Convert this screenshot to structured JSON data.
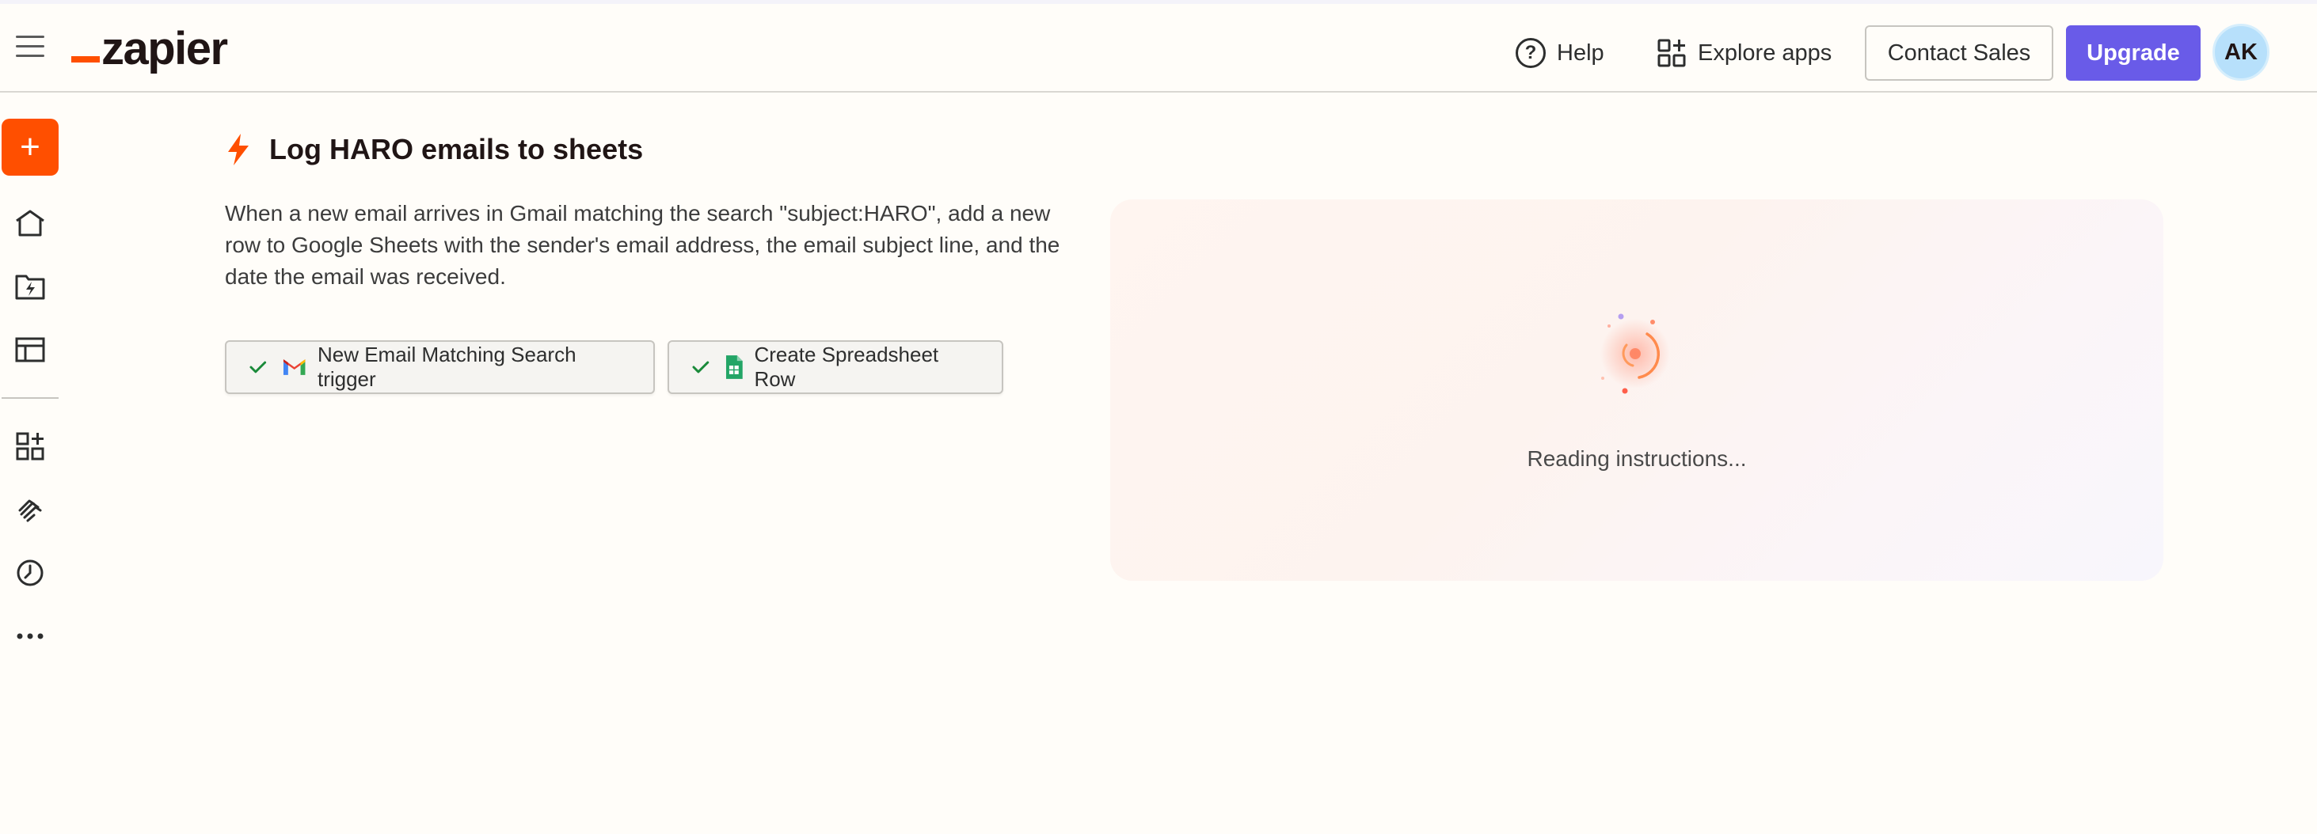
{
  "header": {
    "logo_text": "zapier",
    "help_label": "Help",
    "explore_label": "Explore apps",
    "contact_label": "Contact Sales",
    "upgrade_label": "Upgrade",
    "avatar_initials": "AK"
  },
  "sidebar": {
    "create_label": "+",
    "items": [
      {
        "icon": "home-icon"
      },
      {
        "icon": "zaps-icon"
      },
      {
        "icon": "tables-icon"
      },
      {
        "icon": "apps-icon"
      },
      {
        "icon": "interfaces-icon"
      },
      {
        "icon": "history-icon"
      },
      {
        "icon": "more-icon"
      }
    ]
  },
  "main": {
    "title": "Log HARO emails to sheets",
    "description": "When a new email arrives in Gmail matching the search \"subject:HARO\", add a new row to Google Sheets with the sender's email address, the email subject line, and the date the email was received.",
    "steps": [
      {
        "app": "gmail-icon",
        "label": "New Email Matching Search trigger"
      },
      {
        "app": "google-sheets-icon",
        "label": "Create Spreadsheet Row"
      }
    ],
    "panel_status": "Reading instructions..."
  },
  "colors": {
    "brand_orange": "#ff4f00",
    "upgrade_purple": "#695be8",
    "avatar_blue": "#b7e0fb",
    "check_green": "#1a8a3a"
  }
}
